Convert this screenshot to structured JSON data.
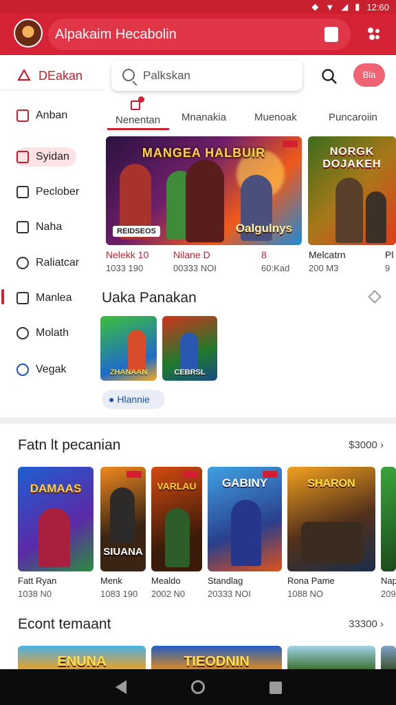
{
  "status_bar": {
    "time": "12:60"
  },
  "app_bar": {
    "title": "Alpakaim Hecabolin"
  },
  "sidebar": {
    "header": "DEakan",
    "items": [
      {
        "label": "Anban"
      },
      {
        "label": "Syidan"
      },
      {
        "label": "Peclober"
      },
      {
        "label": "Naha"
      },
      {
        "label": "Raliatcar"
      },
      {
        "label": "Manlea"
      },
      {
        "label": "Molath"
      },
      {
        "label": "Vegak"
      }
    ]
  },
  "search": {
    "placeholder": "Palkskan"
  },
  "top_badge": "Bla",
  "tabs": [
    {
      "label": "Nenentan"
    },
    {
      "label": "Mnanakia"
    },
    {
      "label": "Muenoak"
    },
    {
      "label": "Puncaroiin"
    }
  ],
  "featured": [
    {
      "overlay_title": "MANGEA HALBUIR",
      "overlay_sub": "Oalgulnys",
      "tag": "REIDSEOS",
      "title": "Nelekk 10",
      "sub": "1033 190"
    },
    {
      "title": "Nilane D",
      "sub": "00333 NOI"
    },
    {
      "title": "8",
      "sub": "60:Kad"
    },
    {
      "overlay_title": "NORGK DOJAKEH",
      "title": "Melcatrn",
      "sub": "200 M3"
    },
    {
      "title": "Pl",
      "sub": "9"
    }
  ],
  "section_small": {
    "title": "Uaka Panakan",
    "cards": [
      {
        "label": "ZHANAAN"
      },
      {
        "label": "CEBRSL"
      }
    ],
    "chip": "Hlannie"
  },
  "row1": {
    "title": "Fatn lt  pecanian",
    "more": "$3000",
    "games": [
      {
        "overlay": "DAMAAS",
        "title": "Fatt Ryan",
        "sub": "1038 N0"
      },
      {
        "overlay": "SIUANA",
        "title": "Menk",
        "sub": "1083 190"
      },
      {
        "overlay": "VARLAU",
        "title": "Mealdo",
        "sub": "2002 N0"
      },
      {
        "overlay": "GABINY",
        "title": "Standlag",
        "sub": "20333 NOI"
      },
      {
        "overlay": "SHARON",
        "title": "Rona Pame",
        "sub": "1088 NO"
      },
      {
        "overlay": "",
        "title": "Nap",
        "sub": "209"
      }
    ]
  },
  "row2": {
    "title": "Econt temaant",
    "more": "33300",
    "cards": [
      {
        "overlay": "ENUNA"
      },
      {
        "overlay": "TIEODNIN"
      },
      {
        "overlay": ""
      }
    ]
  },
  "colors": {
    "brand": "#d52234",
    "accent": "#c51f2f"
  }
}
